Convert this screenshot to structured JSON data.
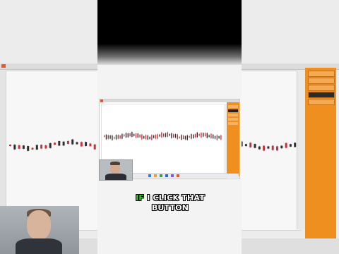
{
  "caption": {
    "highlight": "IF",
    "line1_rest": " I CLICK THAT",
    "line2": "BUTTON",
    "highlight_color": "#38d12e"
  },
  "colors": {
    "panel_orange": "#ef8f1f",
    "candle_up": "#2e2e2e",
    "candle_down": "#c8323c",
    "brand_red_tab": "#e55a2b"
  },
  "icons": [
    "close-icon",
    "maximize-icon",
    "minimize-icon",
    "windows-start-icon"
  ]
}
